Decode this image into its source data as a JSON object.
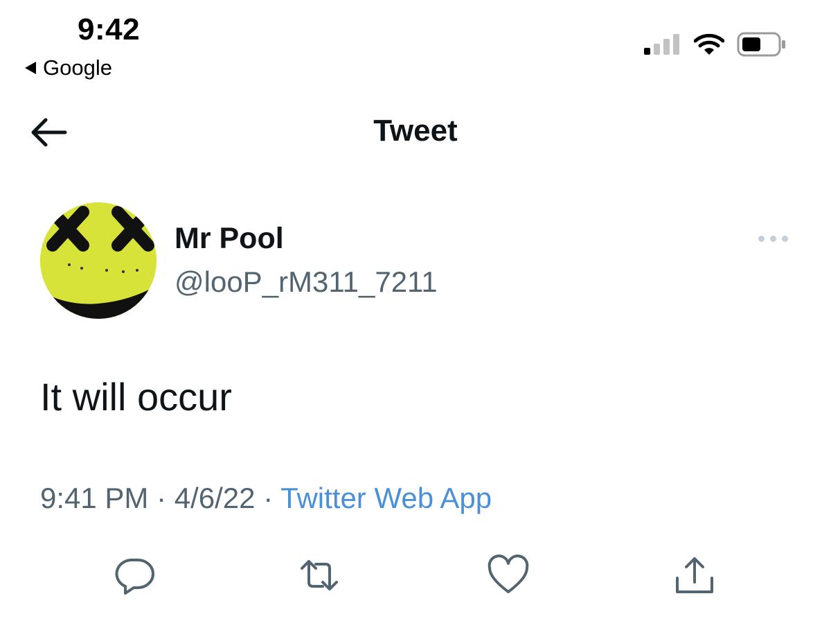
{
  "status_bar": {
    "time": "9:42",
    "back_app_label": "Google"
  },
  "nav": {
    "title": "Tweet"
  },
  "tweet": {
    "author": {
      "name": "Mr Pool",
      "handle": "@looP_rM311_7211"
    },
    "text": "It will occur",
    "time": "9:41 PM",
    "separator": " · ",
    "date": "4/6/22",
    "source": "Twitter Web App"
  },
  "colors": {
    "text_primary": "#0f1419",
    "text_secondary": "#536471",
    "link": "#4a90d9",
    "icon_gray": "#536471",
    "avatar_yellow": "#d8e33a"
  },
  "icons": {
    "reply": "reply-icon",
    "retweet": "retweet-icon",
    "like": "heart-icon",
    "share": "share-icon"
  }
}
